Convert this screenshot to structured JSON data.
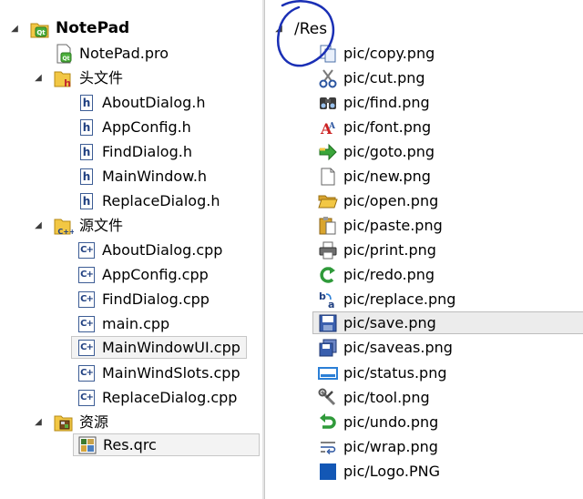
{
  "project_tree": {
    "root_label": "NotePad",
    "pro_file": "NotePad.pro",
    "headers_folder": "头文件",
    "headers": [
      "AboutDialog.h",
      "AppConfig.h",
      "FindDialog.h",
      "MainWindow.h",
      "ReplaceDialog.h"
    ],
    "sources_folder": "源文件",
    "sources": [
      "AboutDialog.cpp",
      "AppConfig.cpp",
      "FindDialog.cpp",
      "main.cpp",
      "MainWindowUI.cpp",
      "MainWindSlots.cpp",
      "ReplaceDialog.cpp"
    ],
    "resources_folder": "资源",
    "resource_file": "Res.qrc",
    "expand_glyph": "◢"
  },
  "resource_tree": {
    "prefix_label": "/Res",
    "files": [
      {
        "label": "pic/copy.png",
        "icon": "copy-icon"
      },
      {
        "label": "pic/cut.png",
        "icon": "cut-icon"
      },
      {
        "label": "pic/find.png",
        "icon": "find-icon"
      },
      {
        "label": "pic/font.png",
        "icon": "font-icon"
      },
      {
        "label": "pic/goto.png",
        "icon": "goto-icon"
      },
      {
        "label": "pic/new.png",
        "icon": "new-icon"
      },
      {
        "label": "pic/open.png",
        "icon": "open-icon"
      },
      {
        "label": "pic/paste.png",
        "icon": "paste-icon"
      },
      {
        "label": "pic/print.png",
        "icon": "print-icon"
      },
      {
        "label": "pic/redo.png",
        "icon": "redo-icon"
      },
      {
        "label": "pic/replace.png",
        "icon": "replace-icon"
      },
      {
        "label": "pic/save.png",
        "icon": "save-icon"
      },
      {
        "label": "pic/saveas.png",
        "icon": "saveas-icon"
      },
      {
        "label": "pic/status.png",
        "icon": "status-icon"
      },
      {
        "label": "pic/tool.png",
        "icon": "tool-icon"
      },
      {
        "label": "pic/undo.png",
        "icon": "undo-icon"
      },
      {
        "label": "pic/wrap.png",
        "icon": "wrap-icon"
      },
      {
        "label": "pic/Logo.PNG",
        "icon": "logo-icon"
      }
    ]
  },
  "colors": {
    "selection_fill": "#f3f3f3",
    "selection_border": "#c7c7c7",
    "icon_blue": "#3d5d95",
    "annotation_ink": "#1a2fb5"
  }
}
